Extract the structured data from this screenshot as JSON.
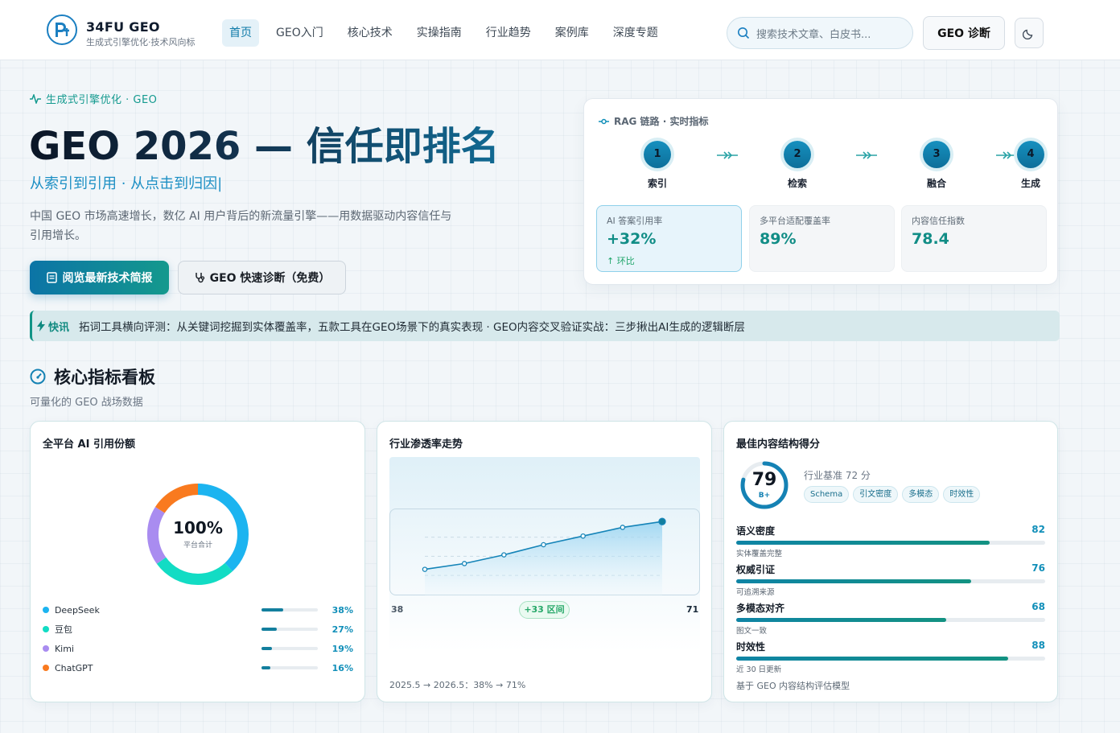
{
  "header": {
    "brand_name": "34FU GEO",
    "brand_sub": "生成式引擎优化·技术风向标",
    "nav": [
      {
        "label": "首页",
        "active": true
      },
      {
        "label": "GEO入门"
      },
      {
        "label": "核心技术"
      },
      {
        "label": "实操指南"
      },
      {
        "label": "行业趋势"
      },
      {
        "label": "案例库"
      },
      {
        "label": "深度专题"
      }
    ],
    "search_placeholder": "搜索技术文章、白皮书...",
    "diag_button": "GEO 诊断",
    "icons": {
      "search": "search-icon",
      "theme": "moon-icon"
    }
  },
  "hero": {
    "eyebrow": "生成式引擎优化 · GEO",
    "title": "GEO 2026 — 信任即排名",
    "subtitle": "从索引到引用 · 从点击到归因|",
    "description": "中国 GEO 市场高速增长，数亿 AI 用户背后的新流量引擎——用数据驱动内容信任与引用增长。",
    "primary_button": "阅览最新技术简报",
    "secondary_button": "GEO 快速诊断（免费）"
  },
  "rag": {
    "title": "RAG 链路 · 实时指标",
    "steps": [
      {
        "num": "1",
        "label": "索引"
      },
      {
        "num": "2",
        "label": "检索"
      },
      {
        "num": "3",
        "label": "融合"
      },
      {
        "num": "4",
        "label": "生成"
      }
    ],
    "metrics": [
      {
        "label": "AI 答案引用率",
        "value": "+32%",
        "trend": "↑ 环比"
      },
      {
        "label": "多平台适配覆盖率",
        "value": "89%"
      },
      {
        "label": "内容信任指数",
        "value": "78.4"
      }
    ]
  },
  "ticker": {
    "tag": "快讯",
    "text": "拓词工具横向评测：从关键词挖掘到实体覆盖率，五款工具在GEO场景下的真实表现 · GEO内容交叉验证实战：三步揪出AI生成的逻辑断层"
  },
  "section": {
    "title": "核心指标看板",
    "subtitle": "可量化的 GEO 战场数据"
  },
  "share_card": {
    "title": "全平台 AI 引用份额",
    "center_value": "100%",
    "center_caption": "平台合计",
    "items": [
      {
        "name": "DeepSeek",
        "value": 38,
        "label": "38%",
        "color": "#1cb4f0"
      },
      {
        "name": "豆包",
        "value": 27,
        "label": "27%",
        "color": "#12dcc4"
      },
      {
        "name": "Kimi",
        "value": 19,
        "label": "19%",
        "color": "#a98cf0"
      },
      {
        "name": "ChatGPT",
        "value": 16,
        "label": "16%",
        "color": "#f97a1f"
      }
    ]
  },
  "trend_card": {
    "title": "行业渗透率走势",
    "low_label": "38",
    "high_label": "71",
    "badge": "+33 区间",
    "footer": "2025.5 → 2026.5：38% → 71%"
  },
  "chart_data": {
    "type": "line",
    "values": [
      38,
      42,
      48,
      55,
      61,
      67,
      71
    ],
    "ylim": [
      20,
      80
    ]
  },
  "score_card": {
    "title": "最佳内容结构得分",
    "score": "79",
    "score_value": 79,
    "grade": "B+",
    "benchmark": "行业基准 72 分",
    "tags": [
      "Schema",
      "引文密度",
      "多模态",
      "时效性"
    ],
    "bars": [
      {
        "name": "语义密度",
        "value": 82,
        "label": "82",
        "note": "实体覆盖完整"
      },
      {
        "name": "权威引证",
        "value": 76,
        "label": "76",
        "note": "可追溯来源"
      },
      {
        "name": "多模态对齐",
        "value": 68,
        "label": "68",
        "note": "图文一致"
      },
      {
        "name": "时效性",
        "value": 88,
        "label": "88",
        "note": "近 30 日更新"
      }
    ],
    "footer": "基于 GEO 内容结构评估模型"
  },
  "colors": {
    "accent_teal": "#14998d",
    "accent_blue": "#0c74a6",
    "success_green": "#25a768"
  }
}
